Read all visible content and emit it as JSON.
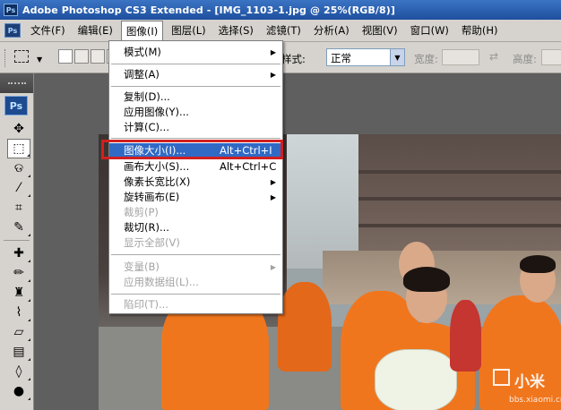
{
  "window": {
    "title": "Adobe Photoshop CS3 Extended - [IMG_1103-1.jpg @ 25%(RGB/8)]",
    "app_badge": "Ps"
  },
  "menubar": {
    "items": [
      "文件(F)",
      "编辑(E)",
      "图像(I)",
      "图层(L)",
      "选择(S)",
      "滤镜(T)",
      "分析(A)",
      "视图(V)",
      "窗口(W)",
      "帮助(H)"
    ]
  },
  "options": {
    "style_label": "样式:",
    "style_value": "正常",
    "width_label": "宽度:",
    "height_label": "高度:"
  },
  "toolbox": {
    "badge": "Ps"
  },
  "image_menu": {
    "items": [
      {
        "label": "模式(M)",
        "shortcut": "",
        "submenu": true,
        "disabled": false
      },
      {
        "label": "调整(A)",
        "shortcut": "",
        "submenu": true,
        "disabled": false
      },
      {
        "label": "复制(D)...",
        "shortcut": "",
        "submenu": false,
        "disabled": false
      },
      {
        "label": "应用图像(Y)...",
        "shortcut": "",
        "submenu": false,
        "disabled": false
      },
      {
        "label": "计算(C)...",
        "shortcut": "",
        "submenu": false,
        "disabled": false
      },
      {
        "label": "图像大小(I)...",
        "shortcut": "Alt+Ctrl+I",
        "submenu": false,
        "disabled": false,
        "highlighted": true
      },
      {
        "label": "画布大小(S)...",
        "shortcut": "Alt+Ctrl+C",
        "submenu": false,
        "disabled": false
      },
      {
        "label": "像素长宽比(X)",
        "shortcut": "",
        "submenu": true,
        "disabled": false
      },
      {
        "label": "旋转画布(E)",
        "shortcut": "",
        "submenu": true,
        "disabled": false
      },
      {
        "label": "裁剪(P)",
        "shortcut": "",
        "submenu": false,
        "disabled": true
      },
      {
        "label": "裁切(R)...",
        "shortcut": "",
        "submenu": false,
        "disabled": false
      },
      {
        "label": "显示全部(V)",
        "shortcut": "",
        "submenu": false,
        "disabled": true
      },
      {
        "label": "变量(B)",
        "shortcut": "",
        "submenu": true,
        "disabled": true
      },
      {
        "label": "应用数据组(L)...",
        "shortcut": "",
        "submenu": false,
        "disabled": true
      },
      {
        "label": "陷印(T)...",
        "shortcut": "",
        "submenu": false,
        "disabled": true
      }
    ]
  },
  "watermark": {
    "brand": "小米",
    "url": "bbs.xiaomi.cn"
  },
  "colors": {
    "menu_highlight": "#316ac5",
    "annotation_box": "#d21f1f",
    "title_bar": "#1e4f9e"
  }
}
